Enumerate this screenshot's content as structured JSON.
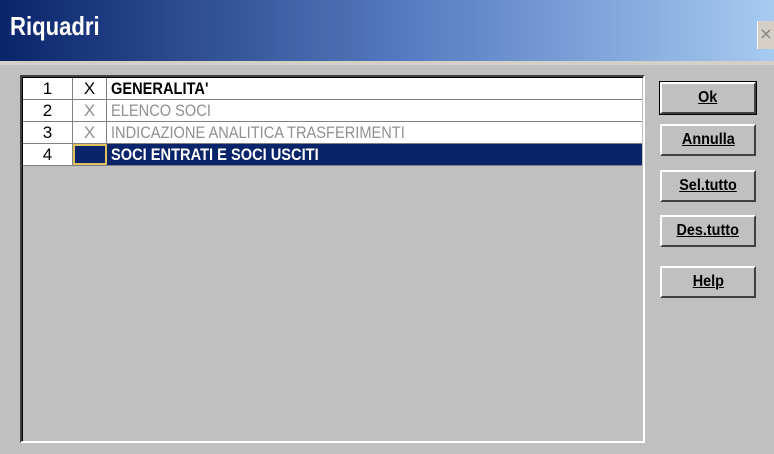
{
  "window": {
    "title": "Riquadri",
    "close_glyph": "×"
  },
  "list": {
    "rows": [
      {
        "number": "1",
        "check": "X",
        "label": "GENERALITA'"
      },
      {
        "number": "2",
        "check": "X",
        "label": "ELENCO SOCI"
      },
      {
        "number": "3",
        "check": "X",
        "label": "INDICAZIONE ANALITICA TRASFERIMENTI"
      },
      {
        "number": "4",
        "check": "",
        "label": "SOCI ENTRATI E SOCI USCITI"
      }
    ],
    "selected_row": "4"
  },
  "buttons": {
    "ok": "Ok",
    "annulla": "Annulla",
    "sel_tutto": "Sel.tutto",
    "des_tutto": "Des.tutto",
    "help": "Help"
  },
  "colors": {
    "title_bar": "#0a246a",
    "selection": "#0a246a",
    "focus_border": "#e0c060",
    "dialog_bg": "#c0c0c0"
  }
}
